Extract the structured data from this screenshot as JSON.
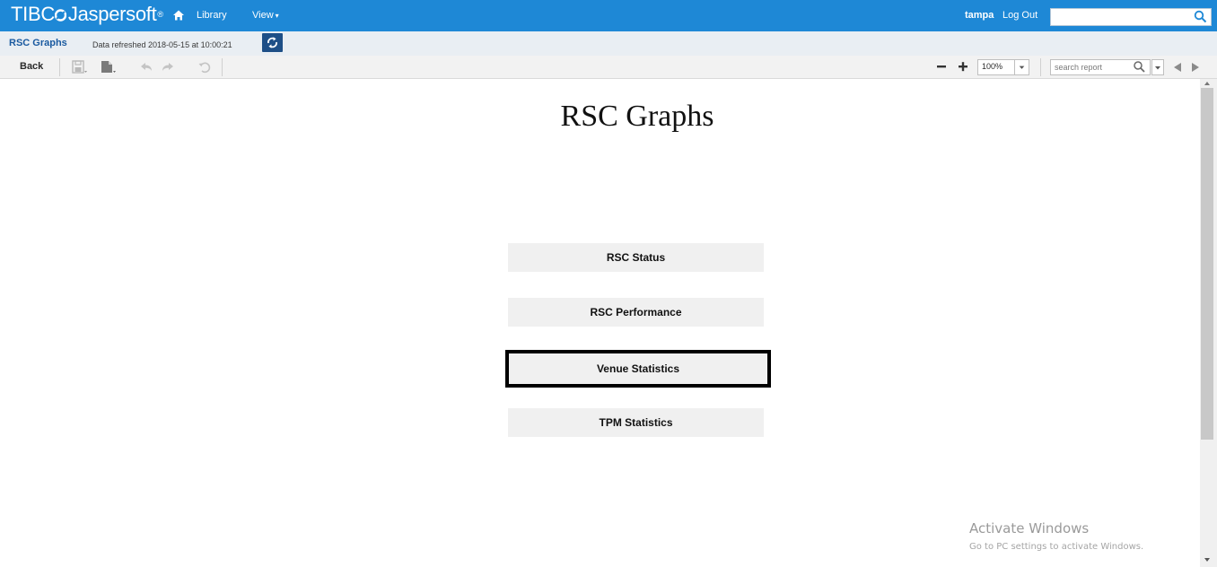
{
  "app": {
    "logo_primary": "TIBC",
    "logo_secondary": "Jaspersoft",
    "logo_tm": "®",
    "brand_color": "#1e88d6"
  },
  "nav": {
    "home_icon": "home-icon",
    "library_label": "Library",
    "view_label": "View",
    "user_name": "tampa",
    "logout_label": "Log Out",
    "global_search_value": "",
    "global_search_icon": "search-icon"
  },
  "report_header": {
    "name": "RSC Graphs",
    "refreshed_text": "Data refreshed 2018-05-15 at 10:00:21",
    "refresh_icon": "refresh-icon"
  },
  "toolbar": {
    "back_label": "Back",
    "icons": [
      "save-icon",
      "export-icon",
      "undo-icon",
      "redo-icon",
      "reset-icon"
    ],
    "zoom_value": "100%",
    "search_placeholder": "search report",
    "prev_icon": "previous-result-icon",
    "next_icon": "next-result-icon"
  },
  "report": {
    "title": "RSC Graphs",
    "buttons": [
      {
        "label": "RSC Status",
        "selected": false
      },
      {
        "label": "RSC Performance",
        "selected": false
      },
      {
        "label": "Venue Statistics",
        "selected": true
      },
      {
        "label": "TPM Statistics",
        "selected": false
      }
    ]
  },
  "watermark": {
    "title": "Activate Windows",
    "subtitle": "Go to PC settings to activate Windows."
  }
}
